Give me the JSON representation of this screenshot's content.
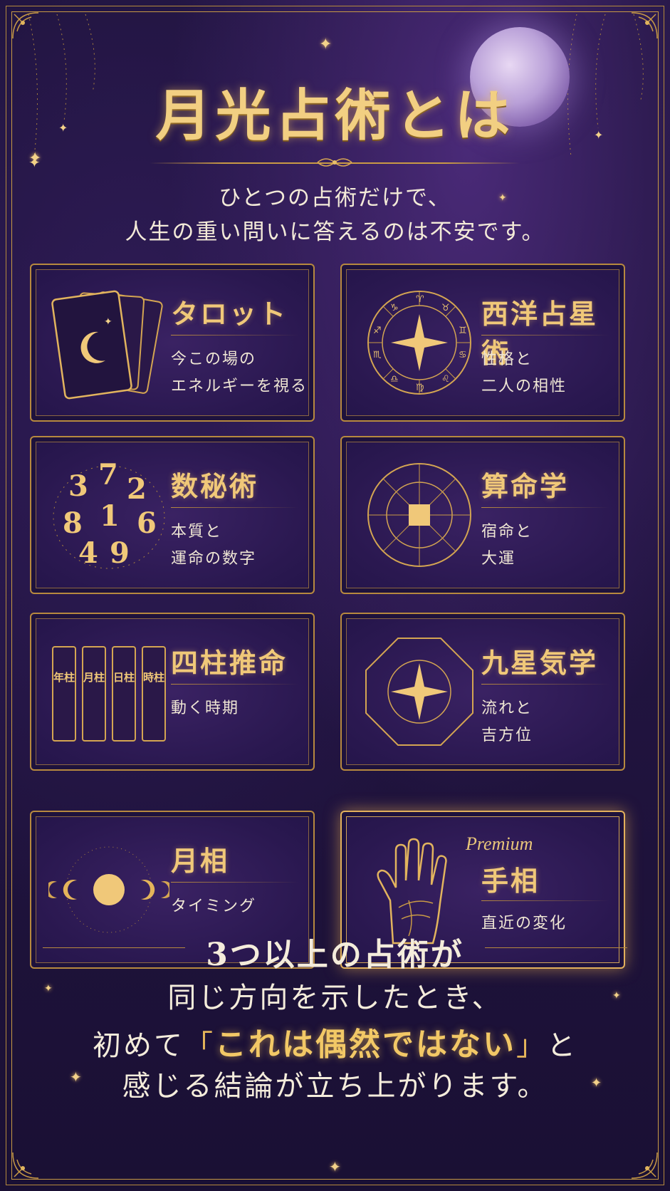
{
  "title": "月光占術とは",
  "intro": {
    "line1": "ひとつの占術だけで、",
    "line2": "人生の重い問いに答えるのは不安です。"
  },
  "cards": [
    {
      "name": "タロット",
      "desc": "今この場の\nエネルギーを視る",
      "icon": "tarot-cards-icon"
    },
    {
      "name": "西洋占星術",
      "desc": "性格と\n二人の相性",
      "icon": "zodiac-wheel-icon"
    },
    {
      "name": "数秘術",
      "desc": "本質と\n運命の数字",
      "icon": "numbers-icon"
    },
    {
      "name": "算命学",
      "desc": "宿命と\n大運",
      "icon": "compass-chart-icon"
    },
    {
      "name": "四柱推命",
      "desc": "動く時期",
      "icon": "four-pillars-icon"
    },
    {
      "name": "九星気学",
      "desc": "流れと\n吉方位",
      "icon": "nine-star-octagon-icon"
    },
    {
      "name": "月相",
      "desc": "タイミング",
      "icon": "moon-phases-icon"
    },
    {
      "name": "手相",
      "desc": "直近の変化",
      "icon": "palm-icon",
      "badge": "Premium"
    }
  ],
  "pillars": [
    "年柱",
    "月柱",
    "日柱",
    "時柱"
  ],
  "numbers": [
    "3",
    "7",
    "2",
    "8",
    "1",
    "6",
    "4",
    "9"
  ],
  "conclusion": {
    "line1": "3つ以上の占術が",
    "line2": "同じ方向を示したとき、",
    "line3_pre": "初めて",
    "line3_open": "「",
    "line3_hl": "これは偶然ではない",
    "line3_close": "」",
    "line3_post": "と",
    "line4": "感じる結論が立ち上がります。"
  },
  "colors": {
    "gold": "#f0c879",
    "bg": "#1c1238",
    "text": "#f3ead8"
  }
}
